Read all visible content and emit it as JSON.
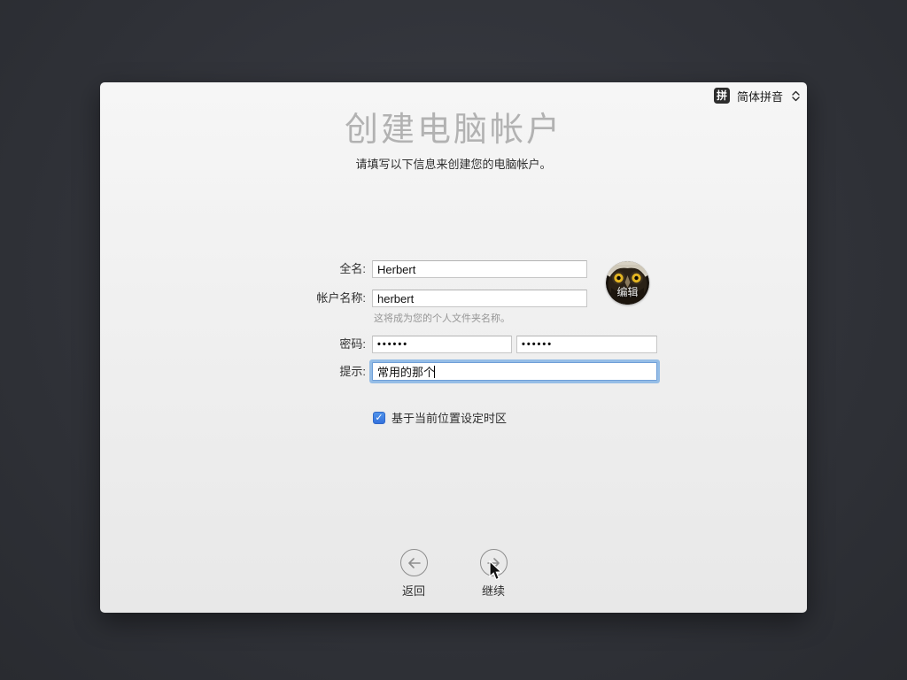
{
  "window": {
    "title": "创建电脑帐户",
    "subtitle": "请填写以下信息来创建您的电脑帐户。"
  },
  "input_method": {
    "badge": "拼",
    "name": "简体拼音",
    "chevron_icon": "chevron-up-down-icon"
  },
  "form": {
    "full_name": {
      "label": "全名:",
      "value": "Herbert"
    },
    "account_name": {
      "label": "帐户名称:",
      "value": "herbert",
      "hint": "这将成为您的个人文件夹名称。"
    },
    "password": {
      "label": "密码:",
      "value": "••••••",
      "confirm_value": "••••••"
    },
    "password_hint": {
      "label": "提示:",
      "value": "常用的那个"
    },
    "avatar": {
      "edit_label": "编辑",
      "icon": "owl-photo-avatar"
    },
    "timezone_checkbox": {
      "label": "基于当前位置设定时区",
      "checked": true,
      "check_glyph": "✓"
    }
  },
  "buttons": {
    "back": {
      "label": "返回",
      "icon": "arrow-left-circle-icon"
    },
    "continue": {
      "label": "继续",
      "icon": "arrow-right-circle-icon"
    }
  },
  "colors": {
    "accent_blue": "#3e7fe0",
    "focus_ring": "#95bde6",
    "panel_bg": "#f0f0f0",
    "desktop_bg": "#2e3036",
    "title_gray": "#b2b2b2"
  }
}
